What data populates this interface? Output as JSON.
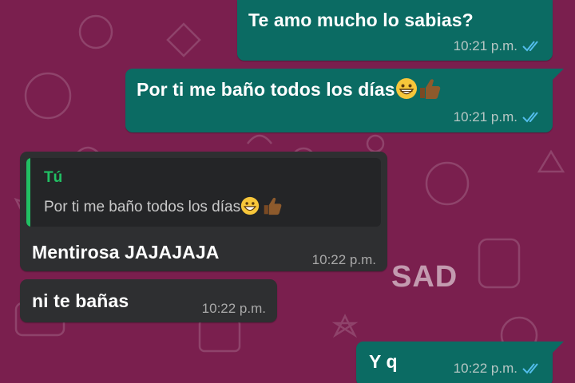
{
  "theme": {
    "background": "#7a1f4e",
    "outgoing_bubble": "#0b6b63",
    "incoming_bubble": "#2e2f31",
    "quote_accent": "#21c063",
    "read_ticks": "#53bdeb"
  },
  "messages": [
    {
      "direction": "outgoing",
      "text": "Te amo mucho lo sabias?",
      "time": "10:21 p.m.",
      "status": "read"
    },
    {
      "direction": "outgoing",
      "text": "Por ti me baño todos los días",
      "emojis": [
        "grinning-face",
        "thumbs-up-medium-dark"
      ],
      "time": "10:21 p.m.",
      "status": "read"
    },
    {
      "direction": "incoming",
      "quoted": {
        "author": "Tú",
        "text": "Por ti me baño todos los días",
        "emojis": [
          "grinning-face",
          "thumbs-up-medium-dark"
        ]
      },
      "text": "Mentirosa JAJAJAJA",
      "time": "10:22 p.m."
    },
    {
      "direction": "incoming",
      "text": "ni te bañas",
      "time": "10:22 p.m."
    },
    {
      "direction": "outgoing",
      "text": "Y q",
      "time": "10:22 p.m.",
      "status": "read"
    }
  ],
  "watermark": "SAD"
}
